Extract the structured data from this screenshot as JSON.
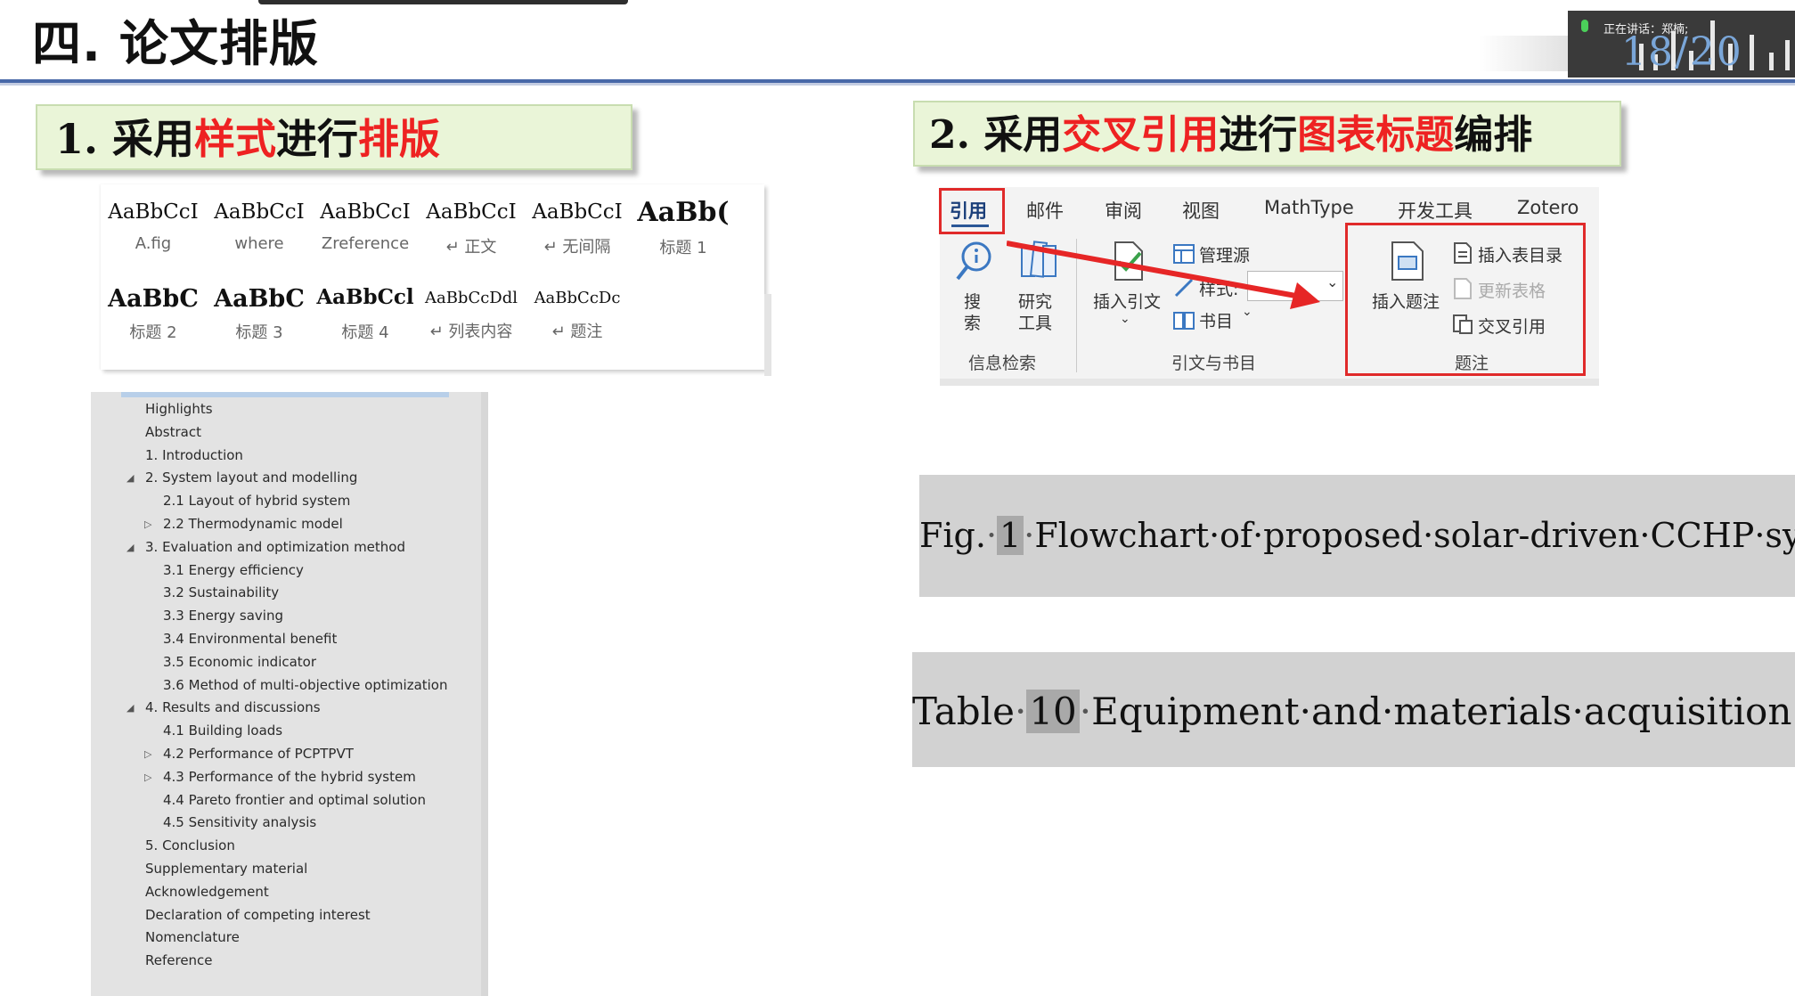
{
  "slide": {
    "title": "四. 论文排版",
    "overlay_status": "正在讲话：郑楠;",
    "overlay_number": "18/20"
  },
  "section1": {
    "number": "1. ",
    "parts": [
      "采用",
      "样式",
      "进行",
      "排版"
    ]
  },
  "section2": {
    "number": "2. ",
    "parts": [
      "采用",
      "交叉引用",
      "进行",
      "图表标题",
      "编排"
    ]
  },
  "styles_gallery": {
    "row1": [
      {
        "sample": "AaBbCcI",
        "name": "A.fig"
      },
      {
        "sample": "AaBbCcI",
        "name": "where"
      },
      {
        "sample": "AaBbCcI",
        "name": "Zreference"
      },
      {
        "sample": "AaBbCcI",
        "name": "↵ 正文"
      },
      {
        "sample": "AaBbCcI",
        "name": "↵ 无间隔"
      },
      {
        "sample": "AaBb(",
        "name": "标题 1"
      }
    ],
    "row2": [
      {
        "sample": "AaBbC",
        "name": "标题 2"
      },
      {
        "sample": "AaBbC",
        "name": "标题 3"
      },
      {
        "sample": "AaBbCcl",
        "name": "标题 4"
      },
      {
        "sample": "AaBbCcDdl",
        "name": "↵ 列表内容"
      },
      {
        "sample": "AaBbCcDc",
        "name": "↵ 题注"
      }
    ]
  },
  "navigation_pane": {
    "items": [
      {
        "label": "Highlights",
        "level": 1,
        "toggle": ""
      },
      {
        "label": "Abstract",
        "level": 1,
        "toggle": ""
      },
      {
        "label": "1. Introduction",
        "level": 1,
        "toggle": ""
      },
      {
        "label": "2. System layout and modelling",
        "level": 1,
        "toggle": "◢"
      },
      {
        "label": "2.1 Layout of hybrid system",
        "level": 2,
        "toggle": ""
      },
      {
        "label": "2.2 Thermodynamic model",
        "level": 2,
        "toggle": "▷"
      },
      {
        "label": "3. Evaluation and optimization method",
        "level": 1,
        "toggle": "◢"
      },
      {
        "label": "3.1 Energy efficiency",
        "level": 2,
        "toggle": ""
      },
      {
        "label": "3.2 Sustainability",
        "level": 2,
        "toggle": ""
      },
      {
        "label": "3.3 Energy saving",
        "level": 2,
        "toggle": ""
      },
      {
        "label": "3.4 Environmental benefit",
        "level": 2,
        "toggle": ""
      },
      {
        "label": "3.5 Economic indicator",
        "level": 2,
        "toggle": ""
      },
      {
        "label": "3.6 Method of multi-objective optimization",
        "level": 2,
        "toggle": ""
      },
      {
        "label": "4. Results and discussions",
        "level": 1,
        "toggle": "◢"
      },
      {
        "label": "4.1 Building loads",
        "level": 2,
        "toggle": ""
      },
      {
        "label": "4.2 Performance of PCPTPVT",
        "level": 2,
        "toggle": "▷"
      },
      {
        "label": "4.3 Performance of the hybrid system",
        "level": 2,
        "toggle": "▷"
      },
      {
        "label": "4.4 Pareto frontier and optimal solution",
        "level": 2,
        "toggle": ""
      },
      {
        "label": "4.5 Sensitivity analysis",
        "level": 2,
        "toggle": ""
      },
      {
        "label": "5. Conclusion",
        "level": 1,
        "toggle": ""
      },
      {
        "label": "Supplementary material",
        "level": 1,
        "toggle": ""
      },
      {
        "label": "Acknowledgement",
        "level": 1,
        "toggle": ""
      },
      {
        "label": "Declaration of competing interest",
        "level": 1,
        "toggle": ""
      },
      {
        "label": "Nomenclature",
        "level": 1,
        "toggle": ""
      },
      {
        "label": "Reference",
        "level": 1,
        "toggle": ""
      }
    ]
  },
  "ribbon": {
    "tabs": [
      "引用",
      "邮件",
      "审阅",
      "视图",
      "MathType",
      "开发工具",
      "Zotero"
    ],
    "active_tab": "引用",
    "search": {
      "line1": "搜",
      "line2": "索"
    },
    "research": {
      "line1": "研究",
      "line2": "工具"
    },
    "insert_citation": "插入引文",
    "manage_sources": "管理源",
    "style": "样式:",
    "bibliography": "书目",
    "insert_caption": "插入题注",
    "insert_table_of_figures": "插入表目录",
    "update_table": "更新表格",
    "cross_reference": "交叉引用",
    "group_info_retrieval": "信息检索",
    "group_citations": "引文与书目",
    "group_captions": "题注"
  },
  "captions": {
    "figure": {
      "prefix": "Fig.",
      "number": "1",
      "text": "Flowchart·of·proposed·solar-driven·CCHP·system.↵"
    },
    "table": {
      "prefix": "Table",
      "number": "10",
      "text": "Equipment·and·materials·acquisition·cost.↵"
    }
  },
  "colors": {
    "accent_red": "#ee2222",
    "section_box_bg": "#eaf5d8",
    "title_rule": "#4868a8",
    "nav_bg": "#e3e3e3",
    "caption_bg": "#d2d2d2"
  }
}
